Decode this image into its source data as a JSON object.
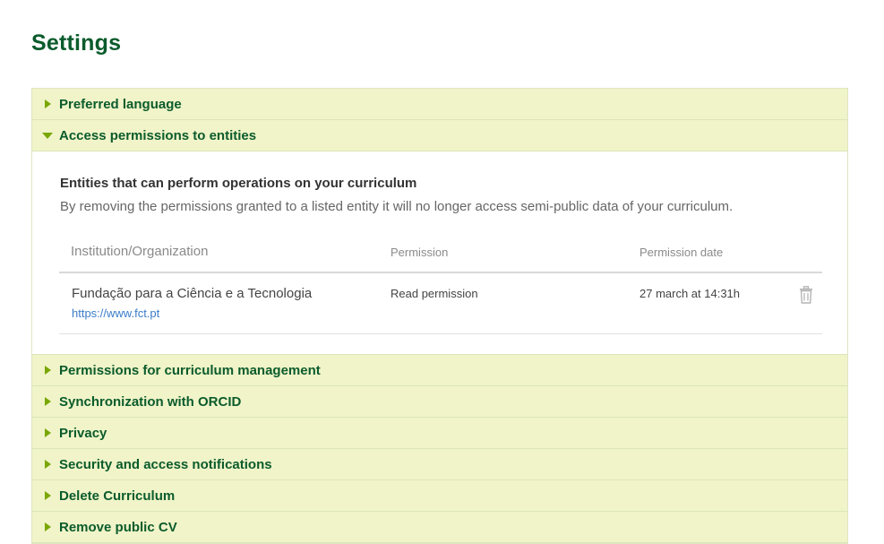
{
  "page": {
    "title": "Settings"
  },
  "accordion": {
    "sections_before": [
      {
        "label": "Preferred language",
        "expanded": false
      }
    ],
    "expanded_section": {
      "label": "Access permissions to entities",
      "expanded": true,
      "heading": "Entities that can perform operations on your curriculum",
      "description": "By removing the permissions granted to a listed entity it will no longer access semi-public data of your curriculum.",
      "table": {
        "columns": {
          "institution": "Institution/Organization",
          "permission": "Permission",
          "date": "Permission date"
        },
        "rows": [
          {
            "institution": "Fundação para a Ciência e a Tecnologia",
            "url": "https://www.fct.pt",
            "permission": "Read permission",
            "date": "27 march at 14:31h",
            "action_icon": "trash-icon"
          }
        ]
      }
    },
    "sections_after": [
      {
        "label": "Permissions for curriculum management",
        "expanded": false
      },
      {
        "label": "Synchronization with ORCID",
        "expanded": false
      },
      {
        "label": "Privacy",
        "expanded": false
      },
      {
        "label": "Security and access notifications",
        "expanded": false
      },
      {
        "label": "Delete Curriculum",
        "expanded": false
      },
      {
        "label": "Remove public CV",
        "expanded": false
      }
    ]
  },
  "colors": {
    "title_green": "#0b5b2c",
    "header_bg": "#f0f4c8",
    "caret_green": "#7aa600",
    "link_blue": "#3a7dc9"
  }
}
